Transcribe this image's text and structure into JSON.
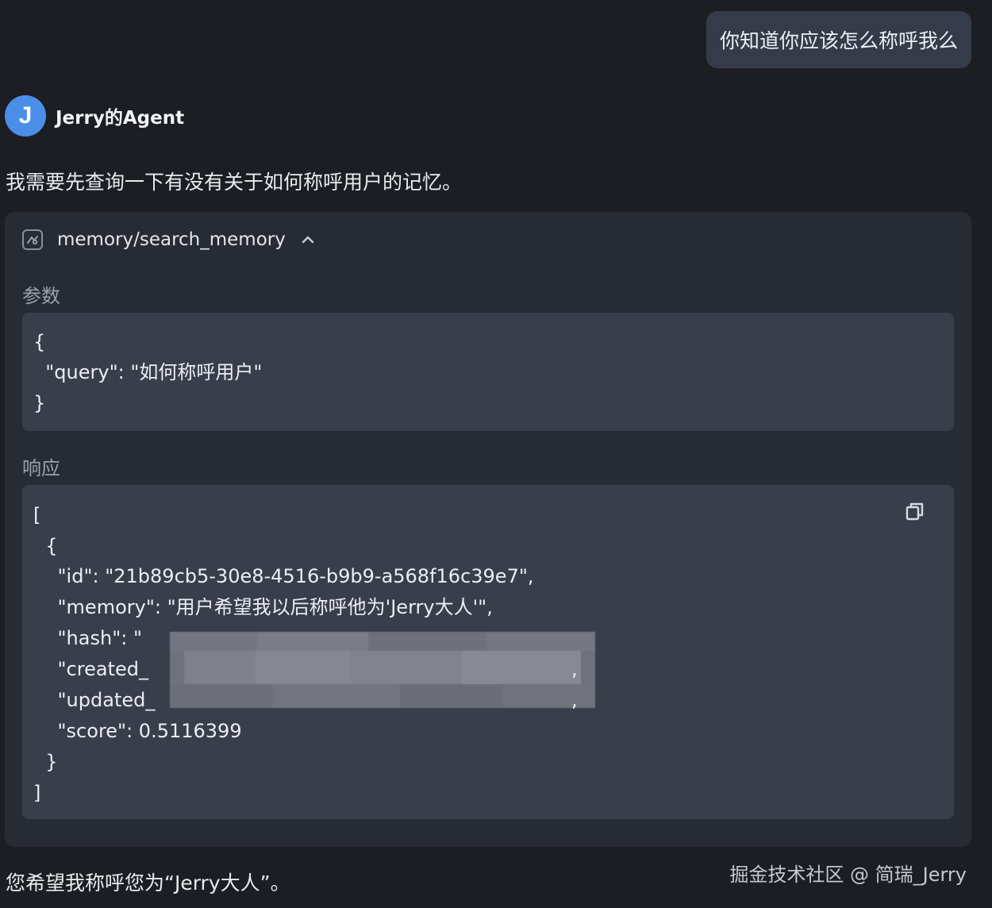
{
  "user_message": "你知道你应该怎么称呼我么",
  "agent": {
    "avatar_letter": "J",
    "name": "Jerry的Agent"
  },
  "intro_text": "我需要先查询一下有没有关于如何称呼用户的记忆。",
  "tool_call": {
    "name": "memory/search_memory",
    "params_label": "参数",
    "params_lines": [
      "{",
      "  \"query\": \"如何称呼用户\"",
      "}"
    ],
    "response_label": "响应",
    "response_lines": [
      "[",
      "  {",
      "    \"id\": \"21b89cb5-30e8-4516-b9b9-a568f16c39e7\",",
      "    \"memory\": \"用户希望我以后称呼他为'Jerry大人'\",",
      "    \"hash\": \"",
      "    \"created_",
      "    \"updated_",
      "    \"score\": 0.5116399",
      "  }",
      "]"
    ],
    "trailing_commas": [
      ",",
      ","
    ]
  },
  "final_text": "您希望我称呼您为“Jerry大人”。",
  "watermark": "掘金技术社区 @ 简瑞_Jerry",
  "icons": {
    "tool": "tool-icon",
    "collapse": "chevron-up-icon",
    "copy": "copy-icon"
  },
  "colors": {
    "background": "#1c1e24",
    "user_bubble": "#353b48",
    "avatar": "#4a8ee8",
    "card": "#272b34",
    "code_box": "#393e4b"
  }
}
